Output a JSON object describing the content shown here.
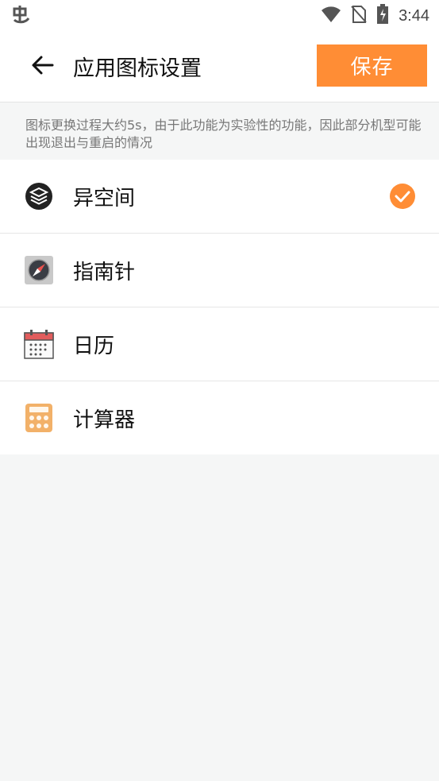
{
  "status_bar": {
    "time": "3:44",
    "icons": [
      "app-logo-icon",
      "wifi-icon",
      "no-sim-icon",
      "battery-charging-icon"
    ]
  },
  "header": {
    "title": "应用图标设置",
    "save_label": "保存",
    "back_icon": "back-arrow-icon"
  },
  "notice": {
    "text": "图标更换过程大约5s，由于此功能为实验性的功能，因此部分机型可能出现退出与重启的情况"
  },
  "icon_options": [
    {
      "label": "异空间",
      "icon": "layers-icon",
      "selected": true
    },
    {
      "label": "指南针",
      "icon": "compass-icon",
      "selected": false
    },
    {
      "label": "日历",
      "icon": "calendar-icon",
      "selected": false
    },
    {
      "label": "计算器",
      "icon": "calculator-icon",
      "selected": false
    }
  ],
  "colors": {
    "accent": "#ff8d35",
    "background": "#f5f6f6",
    "list_background": "#ffffff"
  }
}
